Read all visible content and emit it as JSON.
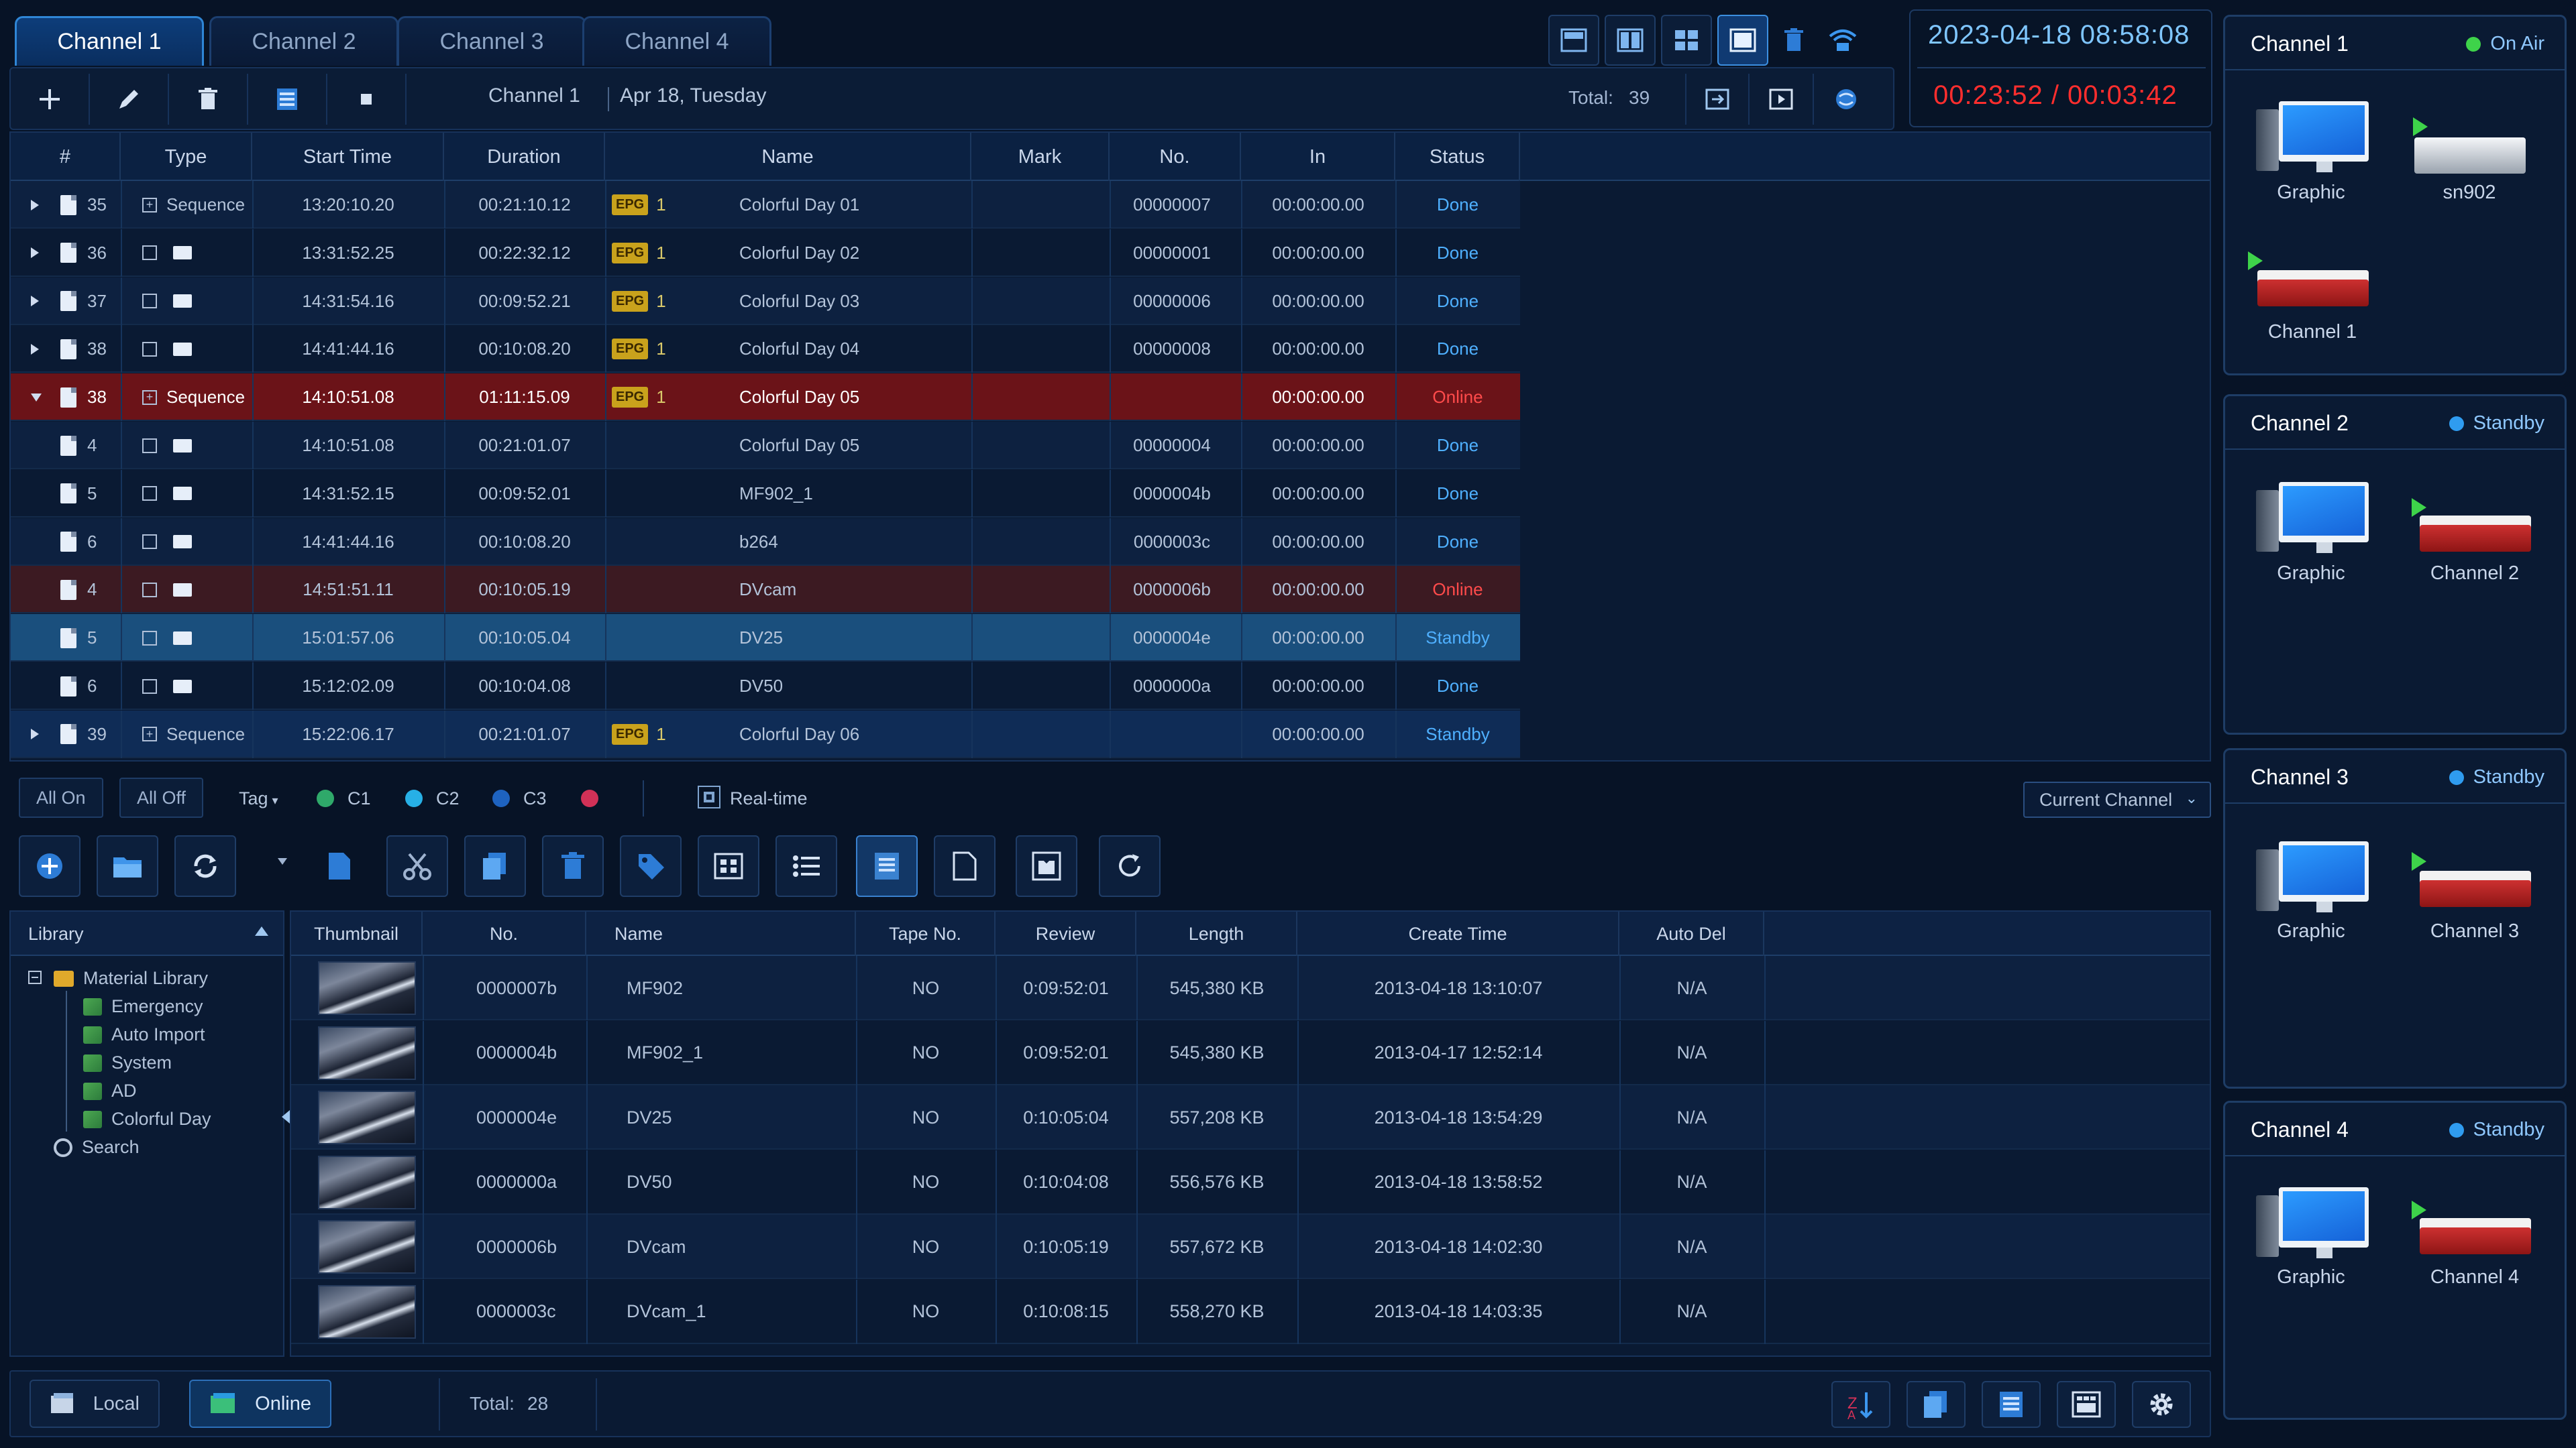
{
  "tabs": [
    "Channel 1",
    "Channel 2",
    "Channel 3",
    "Channel 4"
  ],
  "clock": {
    "datetime": "2023-04-18   08:58:08",
    "timecode": "00:23:52  /  00:03:42"
  },
  "playlist": {
    "channel": "Channel 1",
    "date": "Apr 18, Tuesday",
    "total_label": "Total:",
    "total_value": "39",
    "columns": [
      "#",
      "Type",
      "Start Time",
      "Duration",
      "Name",
      "Mark",
      "No.",
      "In",
      "Status"
    ],
    "rows": [
      {
        "num": "35",
        "type": "Sequence",
        "start": "13:20:10.20",
        "dur": "00:21:10.12",
        "epg": "EPG",
        "epg_n": "1",
        "name": "Colorful Day 01",
        "no": "00000007",
        "in": "00:00:00.00",
        "status": "Done",
        "state": "even",
        "kind": "seq",
        "exp": "right"
      },
      {
        "num": "36",
        "type": "",
        "start": "13:31:52.25",
        "dur": "00:22:32.12",
        "epg": "EPG",
        "epg_n": "1",
        "name": "Colorful Day 02",
        "no": "00000001",
        "in": "00:00:00.00",
        "status": "Done",
        "state": "odd",
        "kind": "clip",
        "exp": "right"
      },
      {
        "num": "37",
        "type": "",
        "start": "14:31:54.16",
        "dur": "00:09:52.21",
        "epg": "EPG",
        "epg_n": "1",
        "name": "Colorful Day 03",
        "no": "00000006",
        "in": "00:00:00.00",
        "status": "Done",
        "state": "even",
        "kind": "clip",
        "exp": "right"
      },
      {
        "num": "38",
        "type": "",
        "start": "14:41:44.16",
        "dur": "00:10:08.20",
        "epg": "EPG",
        "epg_n": "1",
        "name": "Colorful Day 04",
        "no": "00000008",
        "in": "00:00:00.00",
        "status": "Done",
        "state": "odd",
        "kind": "clip",
        "exp": "right"
      },
      {
        "num": "38",
        "type": "Sequence",
        "start": "14:10:51.08",
        "dur": "01:11:15.09",
        "epg": "EPG",
        "epg_n": "1",
        "name": "Colorful Day 05",
        "no": "",
        "in": "00:00:00.00",
        "status": "Online",
        "state": "online",
        "kind": "seq",
        "exp": "down"
      },
      {
        "num": "4",
        "type": "",
        "start": "14:10:51.08",
        "dur": "00:21:01.07",
        "epg": "",
        "epg_n": "",
        "name": "Colorful Day 05",
        "no": "00000004",
        "in": "00:00:00.00",
        "status": "Done",
        "state": "even",
        "kind": "clip",
        "exp": ""
      },
      {
        "num": "5",
        "type": "",
        "start": "14:31:52.15",
        "dur": "00:09:52.01",
        "epg": "",
        "epg_n": "",
        "name": "MF902_1",
        "no": "0000004b",
        "in": "00:00:00.00",
        "status": "Done",
        "state": "odd",
        "kind": "clip",
        "exp": ""
      },
      {
        "num": "6",
        "type": "",
        "start": "14:41:44.16",
        "dur": "00:10:08.20",
        "epg": "",
        "epg_n": "",
        "name": "b264",
        "no": "0000003c",
        "in": "00:00:00.00",
        "status": "Done",
        "state": "even",
        "kind": "clip",
        "exp": ""
      },
      {
        "num": "4",
        "type": "",
        "start": "14:51:51.11",
        "dur": "00:10:05.19",
        "epg": "",
        "epg_n": "",
        "name": "DVcam",
        "no": "0000006b",
        "in": "00:00:00.00",
        "status": "Online",
        "state": "online-dim",
        "kind": "clip",
        "exp": ""
      },
      {
        "num": "5",
        "type": "",
        "start": "15:01:57.06",
        "dur": "00:10:05.04",
        "epg": "",
        "epg_n": "",
        "name": "DV25",
        "no": "0000004e",
        "in": "00:00:00.00",
        "status": "Standby",
        "state": "standby-sel",
        "kind": "clip",
        "exp": ""
      },
      {
        "num": "6",
        "type": "",
        "start": "15:12:02.09",
        "dur": "00:10:04.08",
        "epg": "",
        "epg_n": "",
        "name": "DV50",
        "no": "0000000a",
        "in": "00:00:00.00",
        "status": "Done",
        "state": "odd",
        "kind": "clip",
        "exp": ""
      },
      {
        "num": "39",
        "type": "Sequence",
        "start": "15:22:06.17",
        "dur": "00:21:01.07",
        "epg": "EPG",
        "epg_n": "1",
        "name": "Colorful Day 06",
        "no": "",
        "in": "00:00:00.00",
        "status": "Standby",
        "state": "standby2",
        "kind": "seq",
        "exp": "right"
      }
    ]
  },
  "filter": {
    "all_on": "All On",
    "all_off": "All Off",
    "tag": "Tag",
    "c1": "C1",
    "c2": "C2",
    "c3": "C3",
    "realtime": "Real-time",
    "scope": "Current Channel",
    "colors": {
      "c1": "#2fa96a",
      "c2": "#27b0e6",
      "c3": "#1e63c0",
      "c4": "#d23157"
    }
  },
  "library": {
    "title": "Library",
    "tree": [
      {
        "label": "Material Library",
        "level": 0,
        "icon": "folder"
      },
      {
        "label": "Emergency",
        "level": 1,
        "icon": "node"
      },
      {
        "label": "Auto Import",
        "level": 1,
        "icon": "node"
      },
      {
        "label": "System",
        "level": 1,
        "icon": "node"
      },
      {
        "label": "AD",
        "level": 1,
        "icon": "node"
      },
      {
        "label": "Colorful Day",
        "level": 1,
        "icon": "node"
      },
      {
        "label": "Search",
        "level": 0,
        "icon": "search"
      }
    ]
  },
  "media": {
    "columns": [
      "Thumbnail",
      "No.",
      "Name",
      "Tape No.",
      "Review",
      "Length",
      "Create Time",
      "Auto Del"
    ],
    "rows": [
      {
        "no": "0000007b",
        "name": "MF902",
        "tape": "NO",
        "review": "0:09:52:01",
        "length": "545,380  KB",
        "created": "2013-04-18  13:10:07",
        "autodel": "N/A"
      },
      {
        "no": "0000004b",
        "name": "MF902_1",
        "tape": "NO",
        "review": "0:09:52:01",
        "length": "545,380  KB",
        "created": "2013-04-17  12:52:14",
        "autodel": "N/A"
      },
      {
        "no": "0000004e",
        "name": "DV25",
        "tape": "NO",
        "review": "0:10:05:04",
        "length": "557,208  KB",
        "created": "2013-04-18  13:54:29",
        "autodel": "N/A"
      },
      {
        "no": "0000000a",
        "name": "DV50",
        "tape": "NO",
        "review": "0:10:04:08",
        "length": "556,576  KB",
        "created": "2013-04-18  13:58:52",
        "autodel": "N/A"
      },
      {
        "no": "0000006b",
        "name": "DVcam",
        "tape": "NO",
        "review": "0:10:05:19",
        "length": "557,672  KB",
        "created": "2013-04-18  14:02:30",
        "autodel": "N/A"
      },
      {
        "no": "0000003c",
        "name": "DVcam_1",
        "tape": "NO",
        "review": "0:10:08:15",
        "length": "558,270  KB",
        "created": "2013-04-18  14:03:35",
        "autodel": "N/A"
      }
    ]
  },
  "bottom": {
    "local": "Local",
    "online": "Online",
    "total_label": "Total:",
    "total_value": "28"
  },
  "channels": [
    {
      "title": "Channel 1",
      "state": "On Air",
      "state_color": "#3ed34a",
      "devices": [
        "Graphic",
        "sn902",
        "Channel 1"
      ]
    },
    {
      "title": "Channel 2",
      "state": "Standby",
      "state_color": "#2f9cf0",
      "devices": [
        "Graphic",
        "Channel 2"
      ]
    },
    {
      "title": "Channel 3",
      "state": "Standby",
      "state_color": "#2f9cf0",
      "devices": [
        "Graphic",
        "Channel 3"
      ]
    },
    {
      "title": "Channel 4",
      "state": "Standby",
      "state_color": "#2f9cf0",
      "devices": [
        "Graphic",
        "Channel 4"
      ]
    }
  ]
}
